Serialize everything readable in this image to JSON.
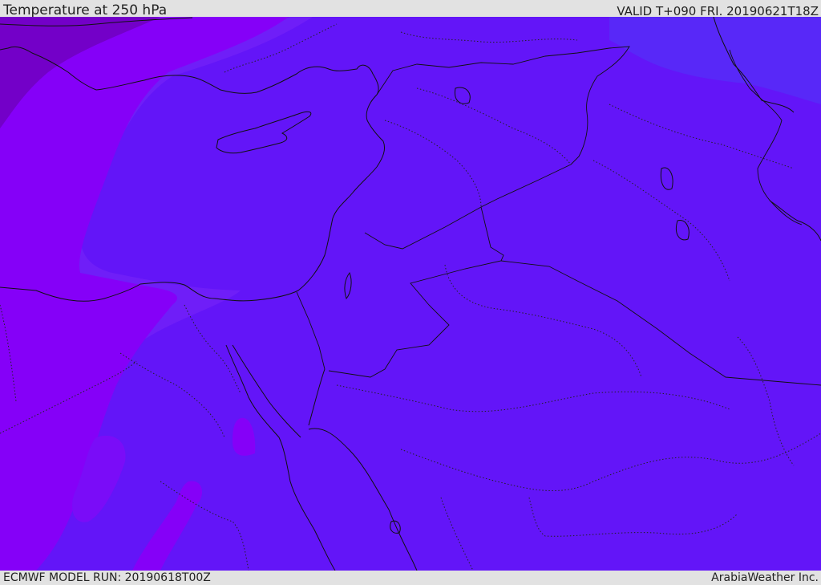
{
  "header": {
    "title": "Temperature at 250 hPa",
    "valid": "VALID T+090 FRI. 20190621T18Z"
  },
  "footer": {
    "model_run": "ECMWF MODEL RUN: 20190618T00Z",
    "credit": "ArabiaWeather Inc."
  },
  "colors": {
    "background_field": "#6315f8",
    "cooler_band": "#6f1ef8",
    "warm_band": "#8500f8",
    "warmest_corner": "#7300c8",
    "cool_northeast": "#5828f8",
    "lines": "#111111",
    "bar": "#e2e2e2"
  }
}
